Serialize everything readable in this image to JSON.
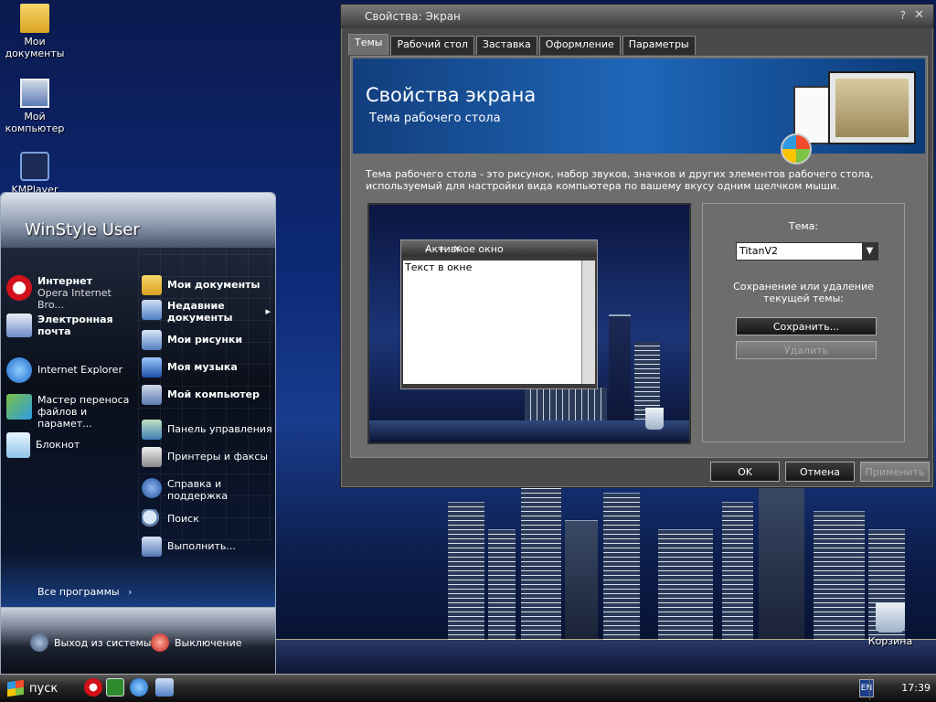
{
  "desktop": {
    "icons": [
      {
        "label": "Мои документы"
      },
      {
        "label": "Мой компьютер"
      },
      {
        "label": "KMPlayer"
      },
      {
        "label": "Корзина"
      }
    ]
  },
  "start_menu": {
    "user": "WinStyle User",
    "left_items": [
      {
        "title": "Интернет",
        "subtitle": "Opera Internet Bro..."
      },
      {
        "title": "Электронная почта",
        "subtitle": ""
      },
      {
        "title": "Internet Explorer",
        "subtitle": ""
      },
      {
        "title": "Мастер переноса файлов и парамет...",
        "subtitle": ""
      },
      {
        "title": "Блокнот",
        "subtitle": ""
      }
    ],
    "right_items": [
      {
        "label": "Мои документы"
      },
      {
        "label": "Недавние документы"
      },
      {
        "label": "Мои рисунки"
      },
      {
        "label": "Моя музыка"
      },
      {
        "label": "Мой компьютер"
      },
      {
        "label": "Панель управления"
      },
      {
        "label": "Принтеры и факсы"
      },
      {
        "label": "Справка и поддержка"
      },
      {
        "label": "Поиск"
      },
      {
        "label": "Выполнить..."
      }
    ],
    "all_programs": "Все программы",
    "logoff": "Выход из системы",
    "shutdown": "Выключение"
  },
  "dialog": {
    "title": "Свойства: Экран",
    "help": "?",
    "close": "✕",
    "tabs": [
      "Темы",
      "Рабочий стол",
      "Заставка",
      "Оформление",
      "Параметры"
    ],
    "banner_title": "Свойства экрана",
    "banner_subtitle": "Тема рабочего стола",
    "description": "Тема рабочего стола - это рисунок, набор звуков, значков и других элементов рабочего стола, используемый для настройки вида компьютера по вашему вкусу одним щелчком мыши.",
    "preview_window_title": "Активное окно",
    "preview_window_text": "Текст в окне",
    "theme_label": "Тема:",
    "theme_value": "TitanV2",
    "save_delete_label": "Сохранение или удаление текущей темы:",
    "save_button": "Сохранить...",
    "delete_button": "Удалить",
    "ok": "OK",
    "cancel": "Отмена",
    "apply": "Применить"
  },
  "taskbar": {
    "start_label": "пуск",
    "lang": "EN",
    "clock": "17:39"
  },
  "colors": {
    "accent": "#1f67b8",
    "dialog_bg": "#6d6d6d"
  }
}
